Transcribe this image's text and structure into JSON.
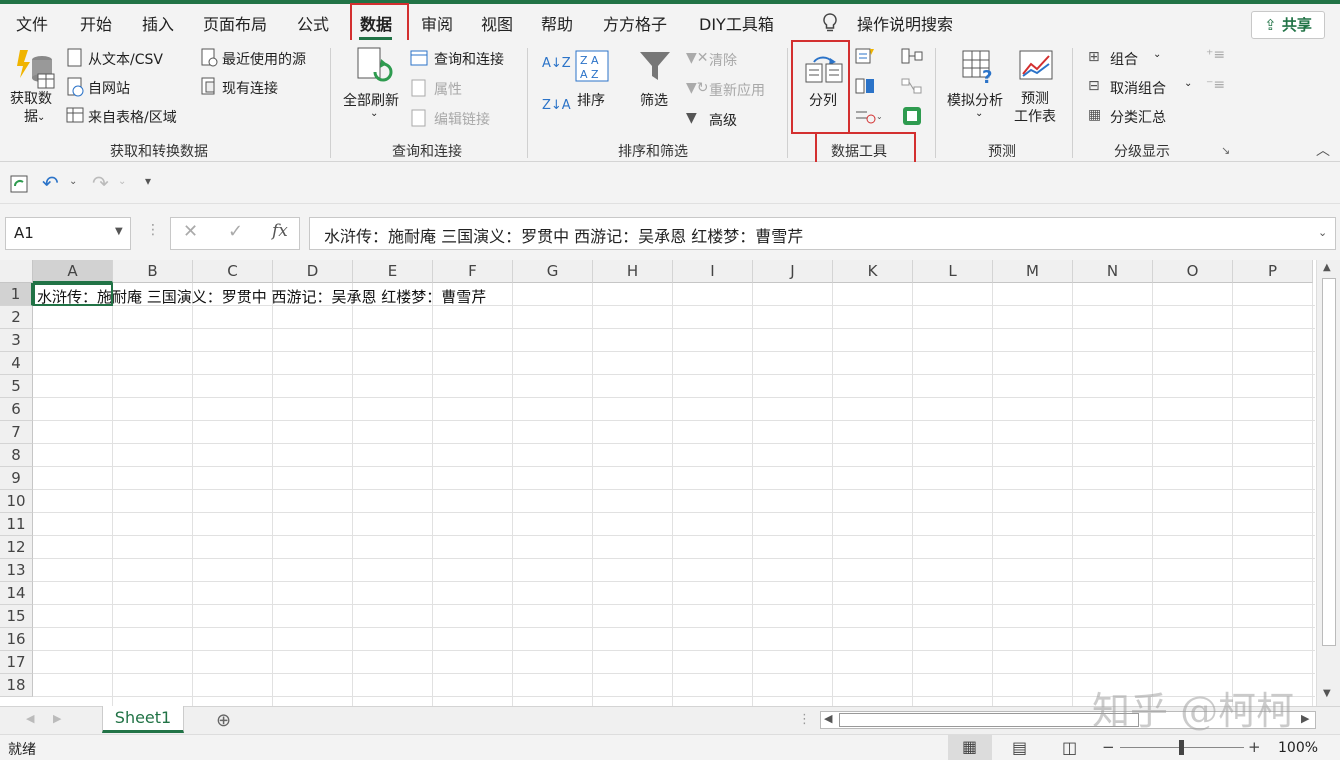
{
  "tabs": [
    "文件",
    "开始",
    "插入",
    "页面布局",
    "公式",
    "数据",
    "审阅",
    "视图",
    "帮助",
    "方方格子",
    "DIY工具箱"
  ],
  "tell_me": "操作说明搜索",
  "share_label": "共享",
  "ribbon": {
    "get_data": {
      "big_label": "获取数\n据",
      "items": [
        "从文本/CSV",
        "自网站",
        "来自表格/区域",
        "最近使用的源",
        "现有连接"
      ],
      "group": "获取和转换数据"
    },
    "queries": {
      "big_label": "全部刷新",
      "items": [
        "查询和连接",
        "属性",
        "编辑链接"
      ],
      "group": "查询和连接"
    },
    "sort_filter": {
      "sort": "排序",
      "filter": "筛选",
      "items": [
        "清除",
        "重新应用",
        "高级"
      ],
      "group": "排序和筛选"
    },
    "data_tools": {
      "big_label": "分列",
      "group": "数据工具"
    },
    "forecast": {
      "whatif": "模拟分析",
      "forecast_sheet": "预测\n工作表",
      "group": "预测"
    },
    "outline": {
      "items": [
        "组合",
        "取消组合",
        "分类汇总"
      ],
      "group": "分级显示"
    }
  },
  "name_box": "A1",
  "formula": "水浒传：施耐庵 三国演义：罗贯中 西游记：吴承恩 红楼梦：曹雪芹",
  "columns": [
    "A",
    "B",
    "C",
    "D",
    "E",
    "F",
    "G",
    "H",
    "I",
    "J",
    "K",
    "L",
    "M",
    "N",
    "O",
    "P"
  ],
  "rows": [
    "1",
    "2",
    "3",
    "4",
    "5",
    "6",
    "7",
    "8",
    "9",
    "10",
    "11",
    "12",
    "13",
    "14",
    "15",
    "16",
    "17",
    "18"
  ],
  "cell_a1": "水浒传：施耐庵 三国演义：罗贯中 西游记：吴承恩 红楼梦：曹雪芹",
  "sheet_tab": "Sheet1",
  "status_text": "就绪",
  "zoom": "100%",
  "watermark": "知乎 @柯柯"
}
